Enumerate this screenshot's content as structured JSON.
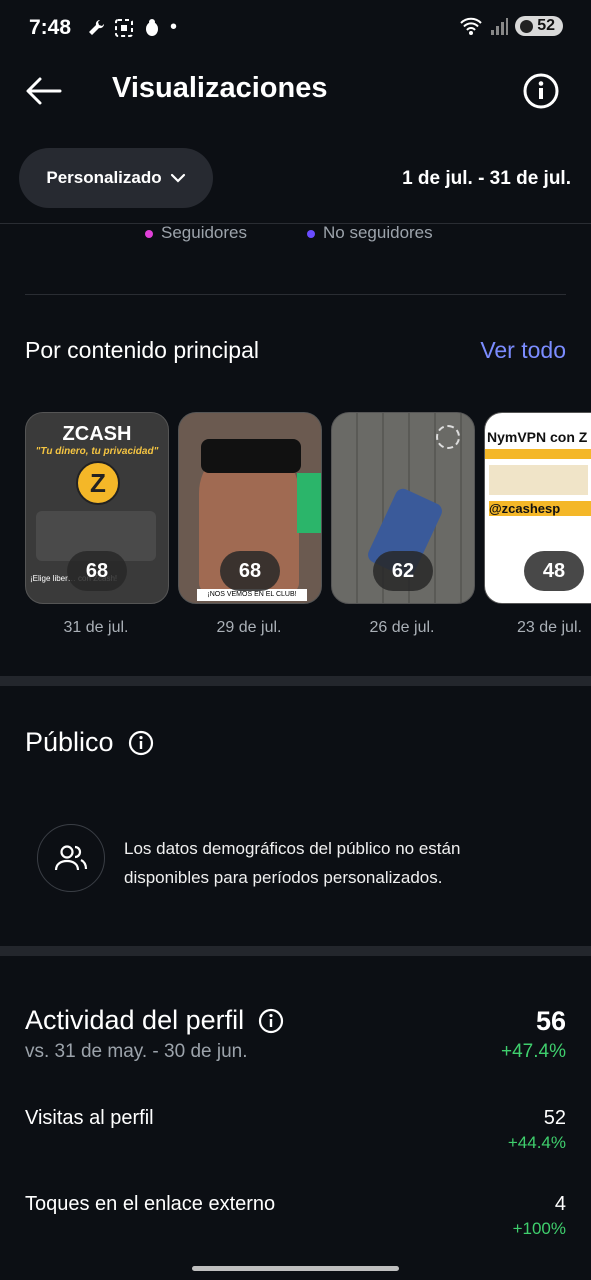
{
  "status_bar": {
    "time": "7:48",
    "battery": "52"
  },
  "header": {
    "title": "Visualizaciones"
  },
  "filter": {
    "label": "Personalizado",
    "date_range": "1 de jul. - 31 de jul."
  },
  "legend": {
    "followers": "Seguidores",
    "non_followers": "No seguidores",
    "followers_color": "#e040d8",
    "non_followers_color": "#6a4cff"
  },
  "top_content": {
    "title": "Por contenido principal",
    "see_all": "Ver todo",
    "items": [
      {
        "count": "68",
        "date": "31 de jul.",
        "heading": "ZCASH",
        "subheading": "\"Tu dinero, tu privacidad\"",
        "footer": "¡Elige liber… con Zcash!"
      },
      {
        "count": "68",
        "date": "29 de jul.",
        "footer": "¡NOS VEMOS EN EL CLUB!"
      },
      {
        "count": "62",
        "date": "26 de jul."
      },
      {
        "count": "48",
        "date": "23 de jul.",
        "heading": "NymVPN con Z",
        "handle": "@zcashesp"
      }
    ]
  },
  "audience": {
    "title": "Público",
    "message": "Los datos demográficos del público no están disponibles para períodos personalizados."
  },
  "profile_activity": {
    "title": "Actividad del perfil",
    "compare": "vs. 31 de may. - 30 de jun.",
    "total": "56",
    "total_change": "+47.4%",
    "rows": [
      {
        "label": "Visitas al perfil",
        "value": "52",
        "change": "+44.4%"
      },
      {
        "label": "Toques en el enlace externo",
        "value": "4",
        "change": "+100%"
      }
    ]
  }
}
